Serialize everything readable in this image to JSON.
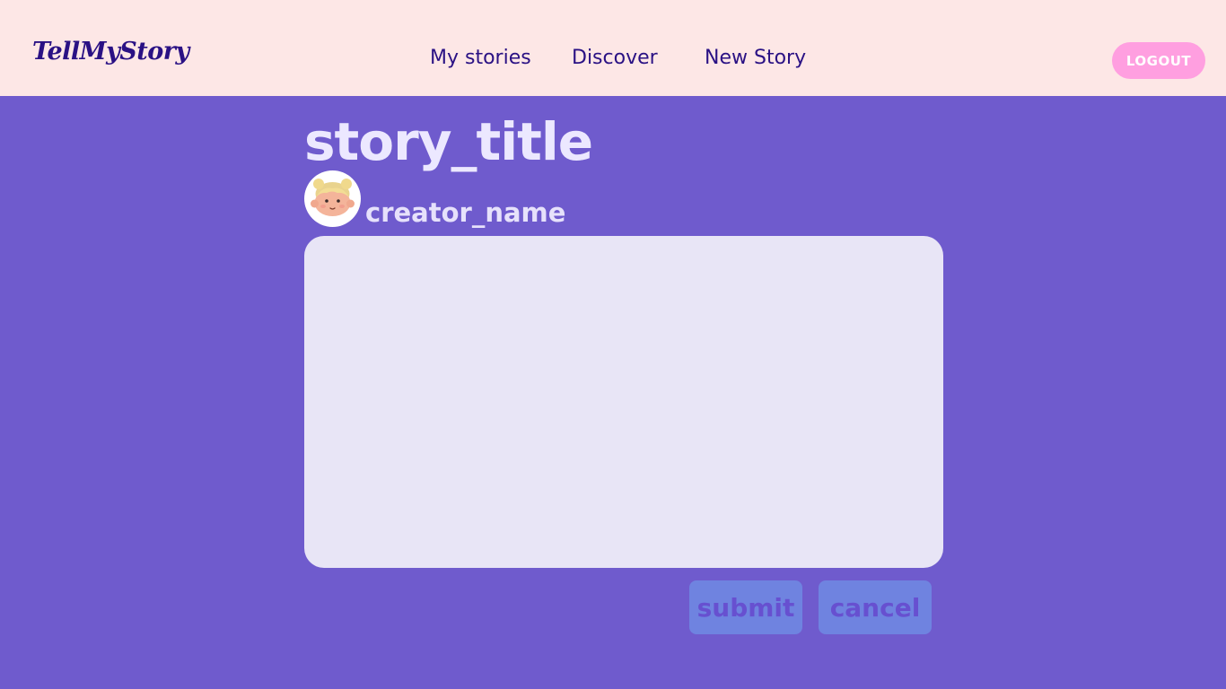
{
  "header": {
    "logo": "TellMyStory",
    "nav": [
      {
        "label": "My stories"
      },
      {
        "label": "Discover"
      },
      {
        "label": "New Story"
      }
    ],
    "logout_label": "LOGOUT"
  },
  "story": {
    "title": "story_title",
    "creator_name": "creator_name",
    "avatar_icon": "cartoon-girl-avatar",
    "content_value": ""
  },
  "actions": {
    "submit_label": "submit",
    "cancel_label": "cancel"
  },
  "colors": {
    "background": "#6f5bcd",
    "header_bg": "#fde7e6",
    "brand": "#2a1184",
    "logout_bg": "#ff9fe0",
    "button_bg": "#6f83e0"
  }
}
